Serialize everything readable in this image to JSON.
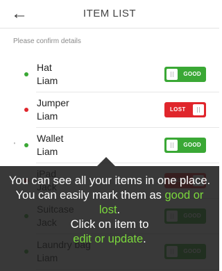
{
  "header": {
    "back_icon": "arrow-left-icon",
    "title": "ITEM LIST"
  },
  "subtitle": "Please confirm details",
  "items": [
    {
      "name": "Hat",
      "owner": "Liam",
      "status": "GOOD",
      "dot_color": "#3aa835",
      "toggle_color": "#3aa835"
    },
    {
      "name": "Jumper",
      "owner": "Liam",
      "status": "LOST",
      "dot_color": "#e0262c",
      "toggle_color": "#e0262c"
    },
    {
      "name": "Wallet",
      "owner": "Liam",
      "status": "GOOD",
      "dot_color": "#3aa835",
      "toggle_color": "#3aa835",
      "side_mark": "'"
    },
    {
      "name": "iPad",
      "owner": "Jack",
      "status": "LOST",
      "dot_color": "#e0262c",
      "toggle_color": "#e0262c"
    },
    {
      "name": "Suitcase",
      "owner": "Jack",
      "status": "GOOD",
      "dot_color": "#3aa835",
      "toggle_color": "#3aa835"
    },
    {
      "name": "Laundry bag",
      "owner": "Liam",
      "status": "GOOD",
      "dot_color": "#3aa835",
      "toggle_color": "#3aa835"
    }
  ],
  "tooltip": {
    "line1": "You can see all your items in one place. You can easily mark them as",
    "highlight1": "good or lost",
    "period1": ".",
    "line2": "Click on item to",
    "highlight2": "edit or update",
    "period2": "."
  },
  "colors": {
    "good": "#3aa835",
    "lost": "#e0262c",
    "highlight": "#7bd83c"
  }
}
